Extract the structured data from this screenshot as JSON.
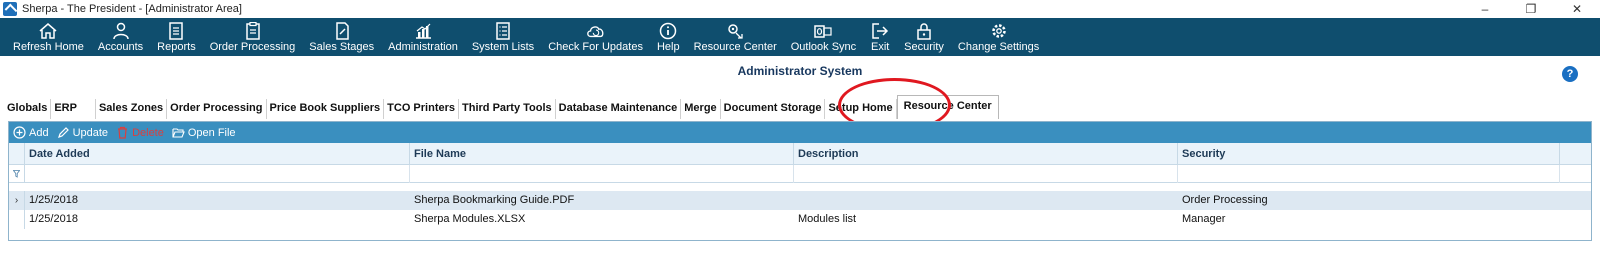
{
  "window": {
    "title": "Sherpa - The President - [Administrator Area]",
    "controls": [
      "–",
      "❐",
      "✕"
    ]
  },
  "toolbar": {
    "items": [
      {
        "label": "Refresh Home",
        "icon": "home-icon"
      },
      {
        "label": "Accounts",
        "icon": "user-icon"
      },
      {
        "label": "Reports",
        "icon": "report-icon"
      },
      {
        "label": "Order Processing",
        "icon": "clipboard-icon"
      },
      {
        "label": "Sales Stages",
        "icon": "document-edit-icon"
      },
      {
        "label": "Administration",
        "icon": "chart-icon"
      },
      {
        "label": "System Lists",
        "icon": "list-icon"
      },
      {
        "label": "Check For Updates",
        "icon": "cloud-refresh-icon"
      },
      {
        "label": "Help",
        "icon": "info-icon"
      },
      {
        "label": "Resource Center",
        "icon": "gear-document-icon"
      },
      {
        "label": "Outlook Sync",
        "icon": "outlook-icon"
      },
      {
        "label": "Exit",
        "icon": "exit-icon"
      },
      {
        "label": "Security",
        "icon": "lock-icon"
      },
      {
        "label": "Change Settings",
        "icon": "gear-icon"
      }
    ]
  },
  "content": {
    "title": "Administrator System",
    "help": "?"
  },
  "tabs": {
    "items": [
      "Globals",
      "ERP",
      "Sales Zones",
      "Order Processing",
      "Price Book Suppliers",
      "TCO Printers",
      "Third Party Tools",
      "Database Maintenance",
      "Merge",
      "Document Storage",
      "Setup Home",
      "Resource Center"
    ],
    "active": "Resource Center"
  },
  "grid": {
    "toolbar": {
      "add": "Add",
      "update": "Update",
      "delete": "Delete",
      "open": "Open File"
    },
    "columns": [
      "Date Added",
      "File Name",
      "Description",
      "Security"
    ],
    "rows": [
      {
        "date": "1/25/2018",
        "file": "Sherpa Bookmarking Guide.PDF",
        "description": "",
        "security": "Order Processing"
      },
      {
        "date": "1/25/2018",
        "file": "Sherpa Modules.XLSX",
        "description": "Modules list",
        "security": "Manager"
      }
    ]
  },
  "colors": {
    "toolbar_bg": "#0f4e6e",
    "grid_toolbar_bg": "#3a8fbf",
    "annotation": "#e01820"
  }
}
